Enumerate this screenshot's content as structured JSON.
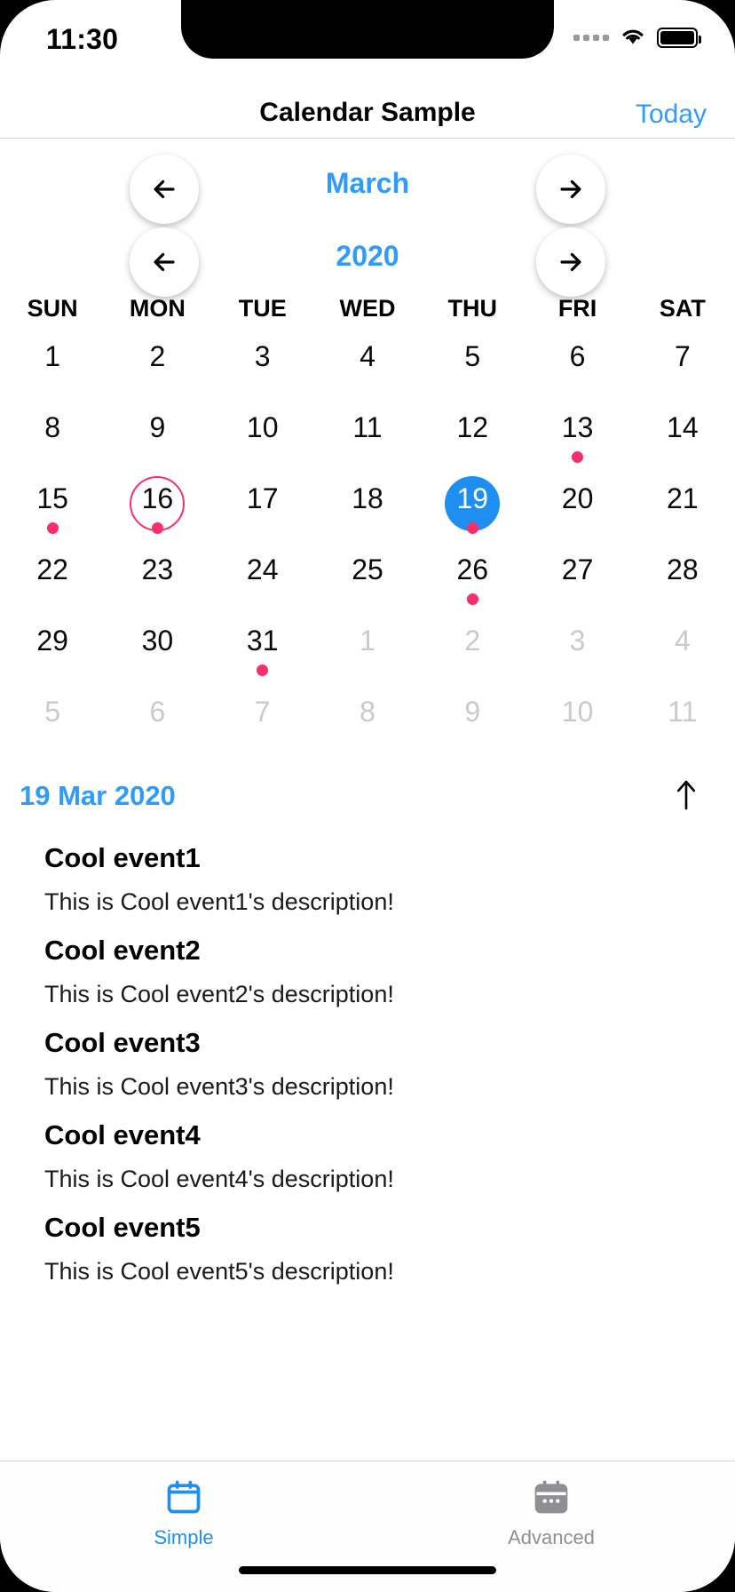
{
  "status_bar": {
    "time": "11:30",
    "signal_icon": "signal-dots-icon",
    "wifi_icon": "wifi-icon",
    "battery_icon": "battery-icon"
  },
  "nav_bar": {
    "title": "Calendar Sample",
    "today_label": "Today"
  },
  "calendar_nav": {
    "month_label": "March",
    "year_label": "2020",
    "prev_month_icon": "arrow-left-icon",
    "next_month_icon": "arrow-right-icon",
    "prev_year_icon": "arrow-left-icon",
    "next_year_icon": "arrow-right-icon"
  },
  "weekdays": [
    "SUN",
    "MON",
    "TUE",
    "WED",
    "THU",
    "FRI",
    "SAT"
  ],
  "calendar": {
    "colors": {
      "accent_blue": "#1f8ef1",
      "link_blue": "#2f9bff",
      "event_dot_pink": "#f92f6a",
      "today_ring_pink": "#f92f6a",
      "other_month_gray": "#c9c9ce"
    },
    "weeks": [
      [
        {
          "day": "1",
          "month": "current",
          "dot": false,
          "today": false,
          "selected": false
        },
        {
          "day": "2",
          "month": "current",
          "dot": false,
          "today": false,
          "selected": false
        },
        {
          "day": "3",
          "month": "current",
          "dot": false,
          "today": false,
          "selected": false
        },
        {
          "day": "4",
          "month": "current",
          "dot": false,
          "today": false,
          "selected": false
        },
        {
          "day": "5",
          "month": "current",
          "dot": false,
          "today": false,
          "selected": false
        },
        {
          "day": "6",
          "month": "current",
          "dot": false,
          "today": false,
          "selected": false
        },
        {
          "day": "7",
          "month": "current",
          "dot": false,
          "today": false,
          "selected": false
        }
      ],
      [
        {
          "day": "8",
          "month": "current",
          "dot": false,
          "today": false,
          "selected": false
        },
        {
          "day": "9",
          "month": "current",
          "dot": false,
          "today": false,
          "selected": false
        },
        {
          "day": "10",
          "month": "current",
          "dot": false,
          "today": false,
          "selected": false
        },
        {
          "day": "11",
          "month": "current",
          "dot": false,
          "today": false,
          "selected": false
        },
        {
          "day": "12",
          "month": "current",
          "dot": false,
          "today": false,
          "selected": false
        },
        {
          "day": "13",
          "month": "current",
          "dot": true,
          "today": false,
          "selected": false
        },
        {
          "day": "14",
          "month": "current",
          "dot": false,
          "today": false,
          "selected": false
        }
      ],
      [
        {
          "day": "15",
          "month": "current",
          "dot": true,
          "today": false,
          "selected": false
        },
        {
          "day": "16",
          "month": "current",
          "dot": true,
          "today": true,
          "selected": false
        },
        {
          "day": "17",
          "month": "current",
          "dot": false,
          "today": false,
          "selected": false
        },
        {
          "day": "18",
          "month": "current",
          "dot": false,
          "today": false,
          "selected": false
        },
        {
          "day": "19",
          "month": "current",
          "dot": true,
          "today": false,
          "selected": true
        },
        {
          "day": "20",
          "month": "current",
          "dot": false,
          "today": false,
          "selected": false
        },
        {
          "day": "21",
          "month": "current",
          "dot": false,
          "today": false,
          "selected": false
        }
      ],
      [
        {
          "day": "22",
          "month": "current",
          "dot": false,
          "today": false,
          "selected": false
        },
        {
          "day": "23",
          "month": "current",
          "dot": false,
          "today": false,
          "selected": false
        },
        {
          "day": "24",
          "month": "current",
          "dot": false,
          "today": false,
          "selected": false
        },
        {
          "day": "25",
          "month": "current",
          "dot": false,
          "today": false,
          "selected": false
        },
        {
          "day": "26",
          "month": "current",
          "dot": true,
          "today": false,
          "selected": false
        },
        {
          "day": "27",
          "month": "current",
          "dot": false,
          "today": false,
          "selected": false
        },
        {
          "day": "28",
          "month": "current",
          "dot": false,
          "today": false,
          "selected": false
        }
      ],
      [
        {
          "day": "29",
          "month": "current",
          "dot": false,
          "today": false,
          "selected": false
        },
        {
          "day": "30",
          "month": "current",
          "dot": false,
          "today": false,
          "selected": false
        },
        {
          "day": "31",
          "month": "current",
          "dot": true,
          "today": false,
          "selected": false
        },
        {
          "day": "1",
          "month": "next",
          "dot": false,
          "today": false,
          "selected": false
        },
        {
          "day": "2",
          "month": "next",
          "dot": false,
          "today": false,
          "selected": false
        },
        {
          "day": "3",
          "month": "next",
          "dot": false,
          "today": false,
          "selected": false
        },
        {
          "day": "4",
          "month": "next",
          "dot": false,
          "today": false,
          "selected": false
        }
      ],
      [
        {
          "day": "5",
          "month": "next",
          "dot": false,
          "today": false,
          "selected": false
        },
        {
          "day": "6",
          "month": "next",
          "dot": false,
          "today": false,
          "selected": false
        },
        {
          "day": "7",
          "month": "next",
          "dot": false,
          "today": false,
          "selected": false
        },
        {
          "day": "8",
          "month": "next",
          "dot": false,
          "today": false,
          "selected": false
        },
        {
          "day": "9",
          "month": "next",
          "dot": false,
          "today": false,
          "selected": false
        },
        {
          "day": "10",
          "month": "next",
          "dot": false,
          "today": false,
          "selected": false
        },
        {
          "day": "11",
          "month": "next",
          "dot": false,
          "today": false,
          "selected": false
        }
      ]
    ]
  },
  "event_section": {
    "selected_date_label": "19 Mar 2020",
    "collapse_icon": "arrow-up-icon",
    "events": [
      {
        "title": "Cool event1",
        "description": "This is Cool event1's description!"
      },
      {
        "title": "Cool event2",
        "description": "This is Cool event2's description!"
      },
      {
        "title": "Cool event3",
        "description": "This is Cool event3's description!"
      },
      {
        "title": "Cool event4",
        "description": "This is Cool event4's description!"
      },
      {
        "title": "Cool event5",
        "description": "This is Cool event5's description!"
      }
    ]
  },
  "tab_bar": {
    "tabs": [
      {
        "label": "Simple",
        "icon": "calendar-simple-icon",
        "active": true
      },
      {
        "label": "Advanced",
        "icon": "calendar-advanced-icon",
        "active": false
      }
    ]
  }
}
